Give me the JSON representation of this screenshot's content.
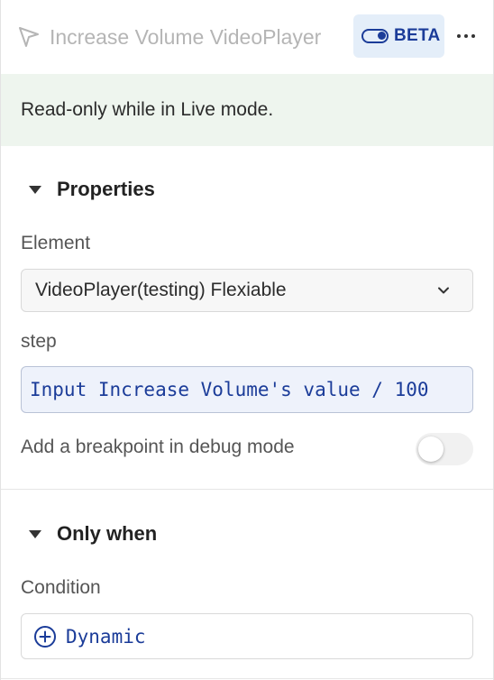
{
  "header": {
    "icon": "cursor-pointer-icon",
    "title": "Increase Volume VideoPlayer",
    "beta_label": "BETA",
    "more_icon": "more-horizontal-icon"
  },
  "notice": {
    "text": "Read-only while in Live mode."
  },
  "properties": {
    "section_title": "Properties",
    "element_label": "Element",
    "element_value": "VideoPlayer(testing) Flexiable",
    "step_label": "step",
    "step_value": "Input Increase Volume's value / 100",
    "breakpoint_label": "Add a breakpoint in debug mode",
    "breakpoint_on": false
  },
  "only_when": {
    "section_title": "Only when",
    "condition_label": "Condition",
    "condition_value": "Dynamic"
  },
  "colors": {
    "accent": "#1b3c99",
    "notice_bg": "#eef5ee",
    "beta_bg": "#e4eef9"
  }
}
